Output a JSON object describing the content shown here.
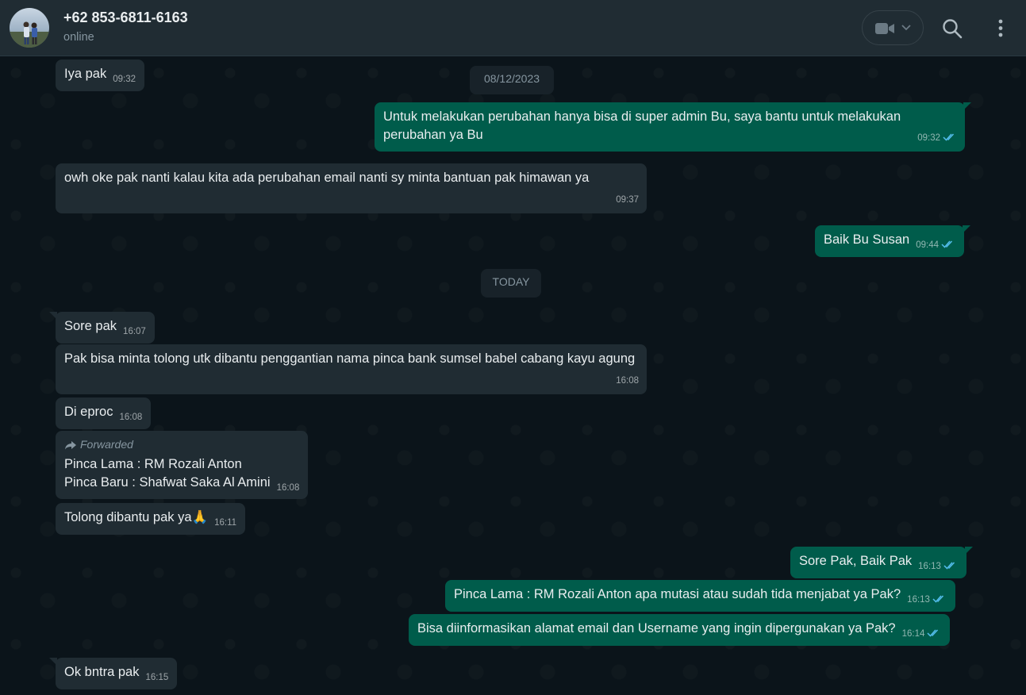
{
  "header": {
    "contact_name": "+62 853-6811-6163",
    "status": "online",
    "icons": {
      "video": "video-camera-icon",
      "dropdown": "chevron-down-icon",
      "search": "search-icon",
      "menu": "kebab-menu-icon"
    }
  },
  "colors": {
    "header_bg": "#202c33",
    "chat_bg": "#0b141a",
    "incoming_bubble": "#202c33",
    "outgoing_bubble": "#005c4b",
    "read_ticks": "#53bdeb"
  },
  "dates": {
    "prev": "08/12/2023",
    "today": "TODAY"
  },
  "messages": [
    {
      "dir": "in",
      "text": "Iya pak",
      "time": "09:32"
    },
    {
      "dir": "out",
      "text": "Untuk melakukan perubahan hanya bisa di super admin Bu, saya bantu untuk melakukan perubahan ya Bu",
      "time": "09:32",
      "read": true
    },
    {
      "dir": "in",
      "text": "owh oke pak nanti kalau kita ada perubahan email nanti sy minta bantuan pak himawan ya",
      "time": "09:37"
    },
    {
      "dir": "out",
      "text": "Baik Bu Susan",
      "time": "09:44",
      "read": true
    },
    {
      "dir": "in",
      "text": "Sore pak",
      "time": "16:07"
    },
    {
      "dir": "in",
      "text": "Pak bisa minta tolong utk dibantu penggantian nama pinca bank sumsel babel cabang kayu agung",
      "time": "16:08"
    },
    {
      "dir": "in",
      "text": "Di eproc",
      "time": "16:08"
    },
    {
      "dir": "in",
      "forwarded_label": "Forwarded",
      "line1": "Pinca Lama : RM Rozali Anton",
      "line2": "Pinca Baru : Shafwat Saka Al Amini",
      "time": "16:08"
    },
    {
      "dir": "in",
      "text": "Tolong dibantu pak ya🙏",
      "time": "16:11"
    },
    {
      "dir": "out",
      "text": "Sore Pak, Baik Pak",
      "time": "16:13",
      "read": true
    },
    {
      "dir": "out",
      "text": "Pinca Lama : RM Rozali Anton apa mutasi atau sudah tida menjabat ya Pak?",
      "time": "16:13",
      "read": true
    },
    {
      "dir": "out",
      "text": "Bisa diinformasikan alamat email dan Username yang ingin dipergunakan ya Pak?",
      "time": "16:14",
      "read": true
    },
    {
      "dir": "in",
      "text": "Ok bntra pak",
      "time": "16:15"
    }
  ]
}
